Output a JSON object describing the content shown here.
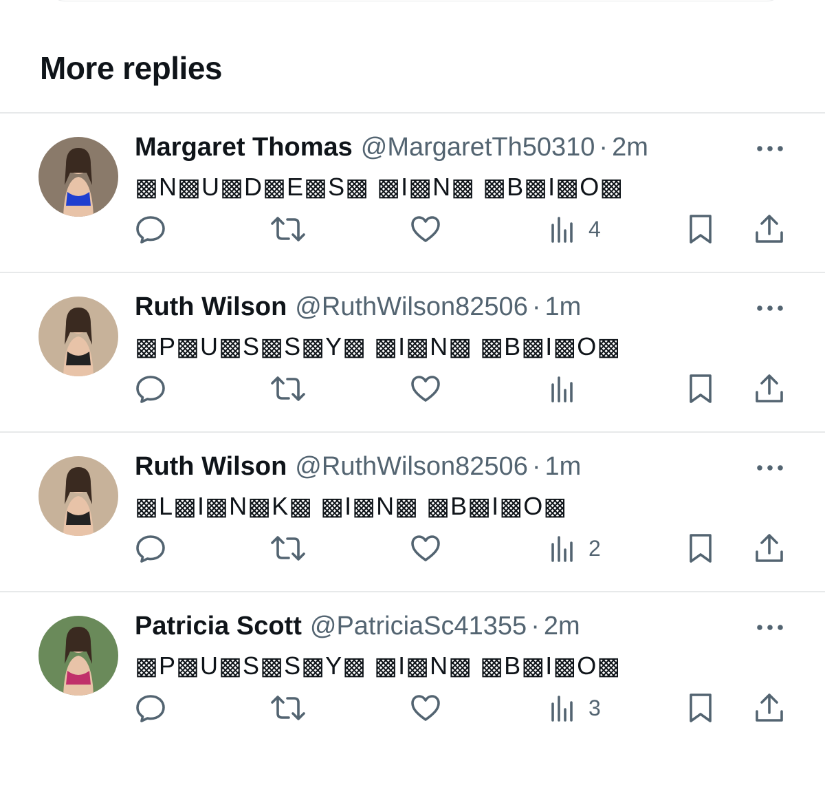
{
  "section": {
    "title": "More replies"
  },
  "replies": [
    {
      "display_name": "Margaret Thomas",
      "handle": "@MargaretTh50310",
      "time": "2m",
      "text": "▩N▩U▩D▩E▩S▩ ▩I▩N▩ ▩B▩I▩O▩",
      "views": "4",
      "avatar": {
        "bg": "#8a7a6a",
        "accent": "#1f3fd0"
      }
    },
    {
      "display_name": "Ruth Wilson",
      "handle": "@RuthWilson82506",
      "time": "1m",
      "text": "▩P▩U▩S▩S▩Y▩ ▩I▩N▩ ▩B▩I▩O▩",
      "views": "",
      "avatar": {
        "bg": "#c7b29a",
        "accent": "#222222"
      }
    },
    {
      "display_name": "Ruth Wilson",
      "handle": "@RuthWilson82506",
      "time": "1m",
      "text": "▩L▩I▩N▩K▩ ▩I▩N▩ ▩B▩I▩O▩",
      "views": "2",
      "avatar": {
        "bg": "#c7b29a",
        "accent": "#222222"
      }
    },
    {
      "display_name": "Patricia Scott",
      "handle": "@PatriciaSc41355",
      "time": "2m",
      "text": "▩P▩U▩S▩S▩Y▩ ▩I▩N▩ ▩B▩I▩O▩",
      "views": "3",
      "avatar": {
        "bg": "#6a8a5a",
        "accent": "#c0306a"
      }
    }
  ],
  "icons": {
    "reply": "reply-icon",
    "retweet": "retweet-icon",
    "like": "heart-icon",
    "views": "views-chart-icon",
    "bookmark": "bookmark-icon",
    "share": "share-icon",
    "more": "more-dots-icon"
  },
  "colors": {
    "icon": "#536471",
    "text": "#0f1419",
    "secondary": "#536471",
    "divider": "#e7e9ea"
  }
}
